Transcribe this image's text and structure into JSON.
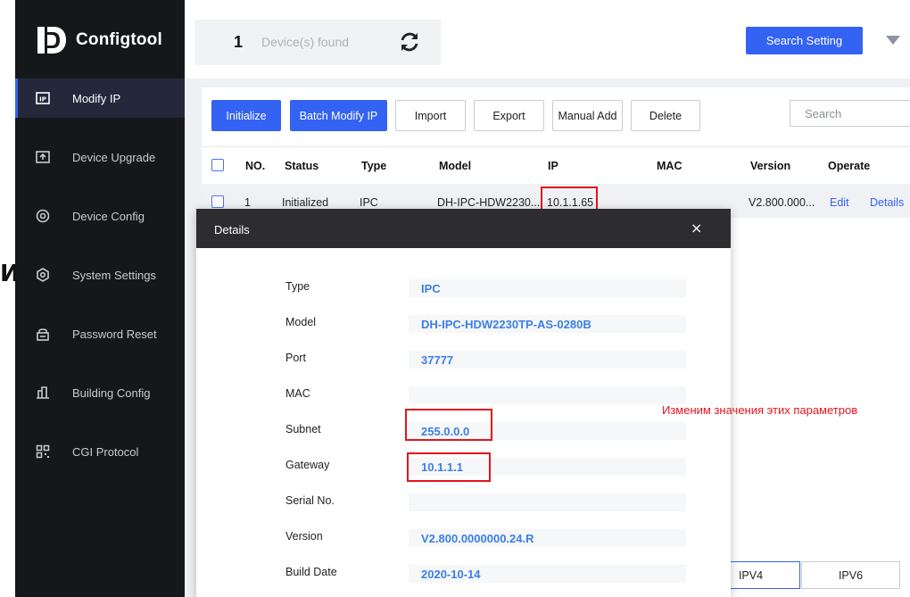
{
  "app": {
    "brand": "Configtool",
    "edge_glyph": "Ид"
  },
  "sidebar": {
    "items": [
      {
        "label": "Modify IP",
        "icon": "ip-icon",
        "active": true
      },
      {
        "label": "Device Upgrade",
        "icon": "upgrade-icon"
      },
      {
        "label": "Device Config",
        "icon": "config-icon"
      },
      {
        "label": "System Settings",
        "icon": "settings-icon"
      },
      {
        "label": "Password Reset",
        "icon": "lock-icon"
      },
      {
        "label": "Building Config",
        "icon": "building-icon"
      },
      {
        "label": "CGI Protocol",
        "icon": "qr-icon"
      }
    ]
  },
  "header": {
    "device_count": "1",
    "device_count_label": "Device(s) found",
    "search_setting_label": "Search Setting"
  },
  "toolbar": {
    "initialize": "Initialize",
    "batch_modify_ip": "Batch Modify IP",
    "import": "Import",
    "export": "Export",
    "manual_add": "Manual Add",
    "delete": "Delete",
    "search_placeholder": "Search"
  },
  "table": {
    "columns": [
      "NO.",
      "Status",
      "Type",
      "Model",
      "IP",
      "MAC",
      "Version",
      "Operate"
    ],
    "rows": [
      {
        "no": "1",
        "status": "Initialized",
        "type": "IPC",
        "model": "DH-IPC-HDW2230...",
        "ip": "10.1.1.65",
        "mac": "",
        "version": "V2.800.000...",
        "edit": "Edit",
        "details": "Details"
      }
    ]
  },
  "tabs": {
    "ipv4": "IPV4",
    "ipv6": "IPV6"
  },
  "details": {
    "title": "Details",
    "close": "×",
    "fields": [
      {
        "label": "Type",
        "value": "IPC"
      },
      {
        "label": "Model",
        "value": "DH-IPC-HDW2230TP-AS-0280B"
      },
      {
        "label": "Port",
        "value": "37777"
      },
      {
        "label": "MAC",
        "value": ""
      },
      {
        "label": "Subnet",
        "value": "255.0.0.0"
      },
      {
        "label": "Gateway",
        "value": "10.1.1.1"
      },
      {
        "label": "Serial No.",
        "value": ""
      },
      {
        "label": "Version",
        "value": "V2.800.0000000.24.R"
      },
      {
        "label": "Build Date",
        "value": "2020-10-14"
      }
    ]
  },
  "annotation": {
    "text": "Изменим значения этих параметров"
  },
  "colors": {
    "accent": "#3463f3",
    "sidebar": "#16171b",
    "highlight": "#e3141b",
    "value_text": "#3a7fe6"
  }
}
